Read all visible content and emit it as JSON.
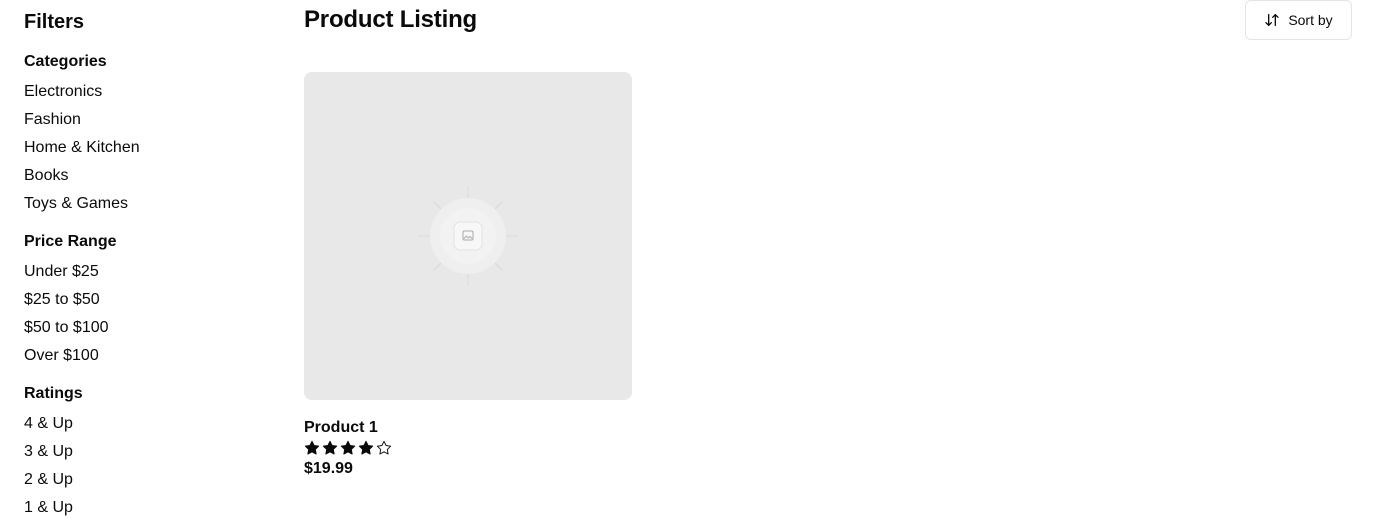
{
  "sidebar": {
    "title": "Filters",
    "groups": [
      {
        "heading": "Categories",
        "items": [
          "Electronics",
          "Fashion",
          "Home & Kitchen",
          "Books",
          "Toys & Games"
        ]
      },
      {
        "heading": "Price Range",
        "items": [
          "Under $25",
          "$25 to $50",
          "$50 to $100",
          "Over $100"
        ]
      },
      {
        "heading": "Ratings",
        "items": [
          "4 & Up",
          "3 & Up",
          "2 & Up",
          "1 & Up"
        ]
      }
    ]
  },
  "main": {
    "title": "Product Listing",
    "sort_label": "Sort by",
    "sort_icon": "arrow-up-down-icon",
    "products": [
      {
        "name": "Product 1",
        "rating": 4,
        "max_rating": 5,
        "price": "$19.99",
        "image_icon": "image-placeholder-icon"
      }
    ]
  },
  "colors": {
    "text": "#0a0a0a",
    "image_placeholder": "#e8e8e8",
    "border": "#e4e4e7"
  }
}
